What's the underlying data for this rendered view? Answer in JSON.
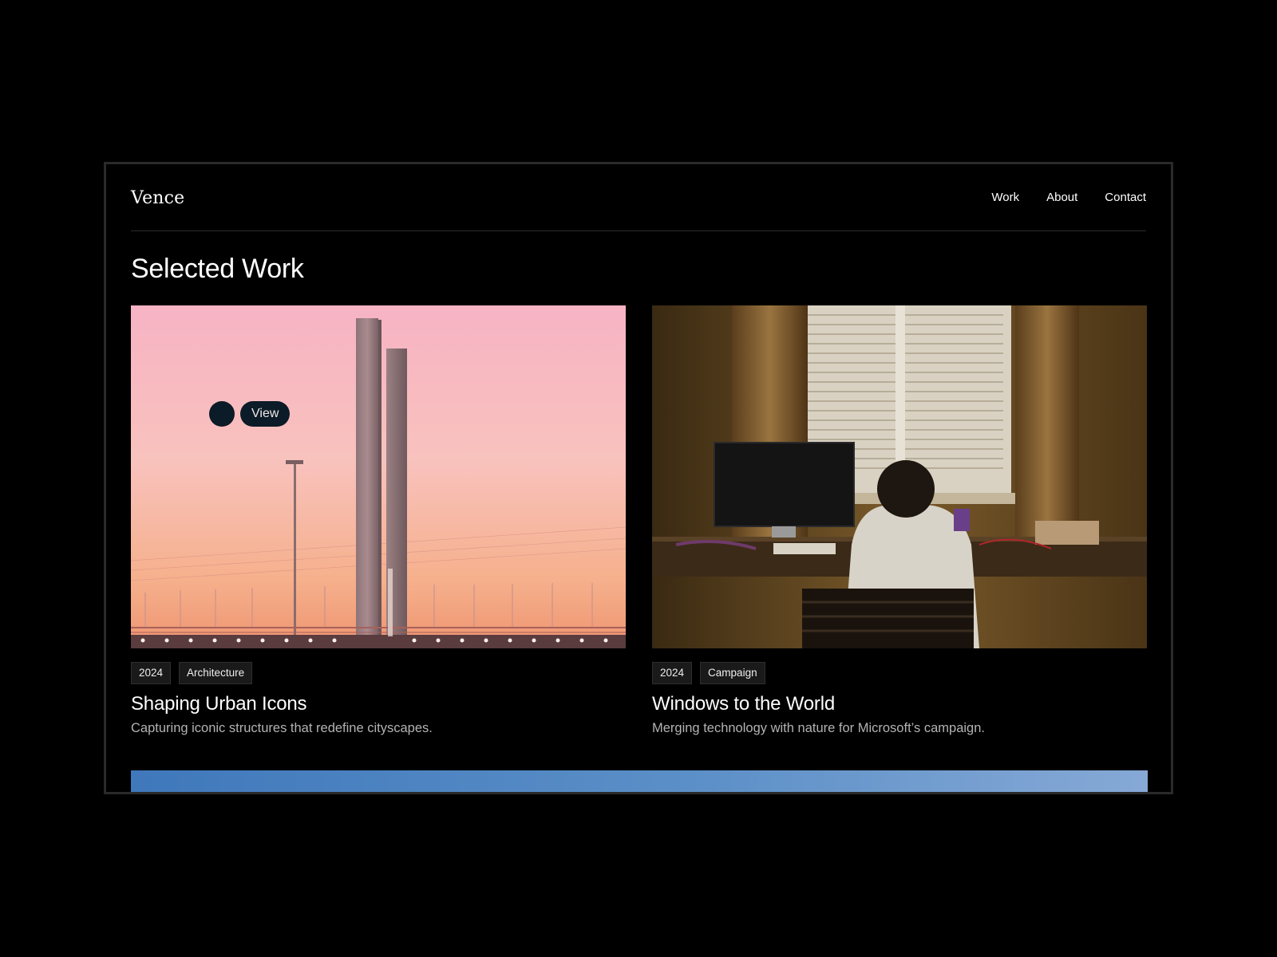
{
  "site": {
    "logo": "Vence",
    "nav": [
      {
        "label": "Work"
      },
      {
        "label": "About"
      },
      {
        "label": "Contact"
      }
    ]
  },
  "page_title": "Selected Work",
  "cursor": {
    "label": "View"
  },
  "projects": [
    {
      "year": "2024",
      "category": "Architecture",
      "title": "Shaping Urban Icons",
      "description": "Capturing iconic structures that redefine cityscapes."
    },
    {
      "year": "2024",
      "category": "Campaign",
      "title": "Windows to the World",
      "description": "Merging technology with nature for Microsoft’s campaign."
    }
  ],
  "colors": {
    "background": "#000000",
    "frame_border": "#2a2a2a",
    "tag_bg": "#1a1a1a",
    "cursor_bg": "#0b1b27",
    "muted_text": "#b3b3b3"
  }
}
